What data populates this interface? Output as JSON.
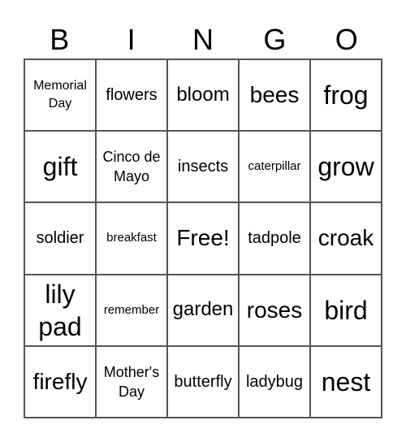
{
  "header": {
    "letters": [
      "B",
      "I",
      "N",
      "G",
      "O"
    ]
  },
  "cells": [
    {
      "text": "Memorial Day",
      "size": "s-xxs"
    },
    {
      "text": "flowers",
      "size": "s-sm"
    },
    {
      "text": "bloom",
      "size": "s-md"
    },
    {
      "text": "bees",
      "size": "s-lg"
    },
    {
      "text": "frog",
      "size": "s-xl"
    },
    {
      "text": "gift",
      "size": "s-xl"
    },
    {
      "text": "Cinco de Mayo",
      "size": "s-xs"
    },
    {
      "text": "insects",
      "size": "s-sm"
    },
    {
      "text": "caterpillar",
      "size": "s-tiny"
    },
    {
      "text": "grow",
      "size": "s-xl"
    },
    {
      "text": "soldier",
      "size": "s-sm"
    },
    {
      "text": "breakfast",
      "size": "s-tiny"
    },
    {
      "text": "Free!",
      "size": "s-lg"
    },
    {
      "text": "tadpole",
      "size": "s-sm"
    },
    {
      "text": "croak",
      "size": "s-lg"
    },
    {
      "text": "lily pad",
      "size": "s-xl"
    },
    {
      "text": "remember",
      "size": "s-tiny"
    },
    {
      "text": "garden",
      "size": "s-md"
    },
    {
      "text": "roses",
      "size": "s-lg"
    },
    {
      "text": "bird",
      "size": "s-xl"
    },
    {
      "text": "firefly",
      "size": "s-lg"
    },
    {
      "text": "Mother's Day",
      "size": "s-xs"
    },
    {
      "text": "butterfly",
      "size": "s-sm"
    },
    {
      "text": "ladybug",
      "size": "s-sm"
    },
    {
      "text": "nest",
      "size": "s-xl"
    }
  ]
}
